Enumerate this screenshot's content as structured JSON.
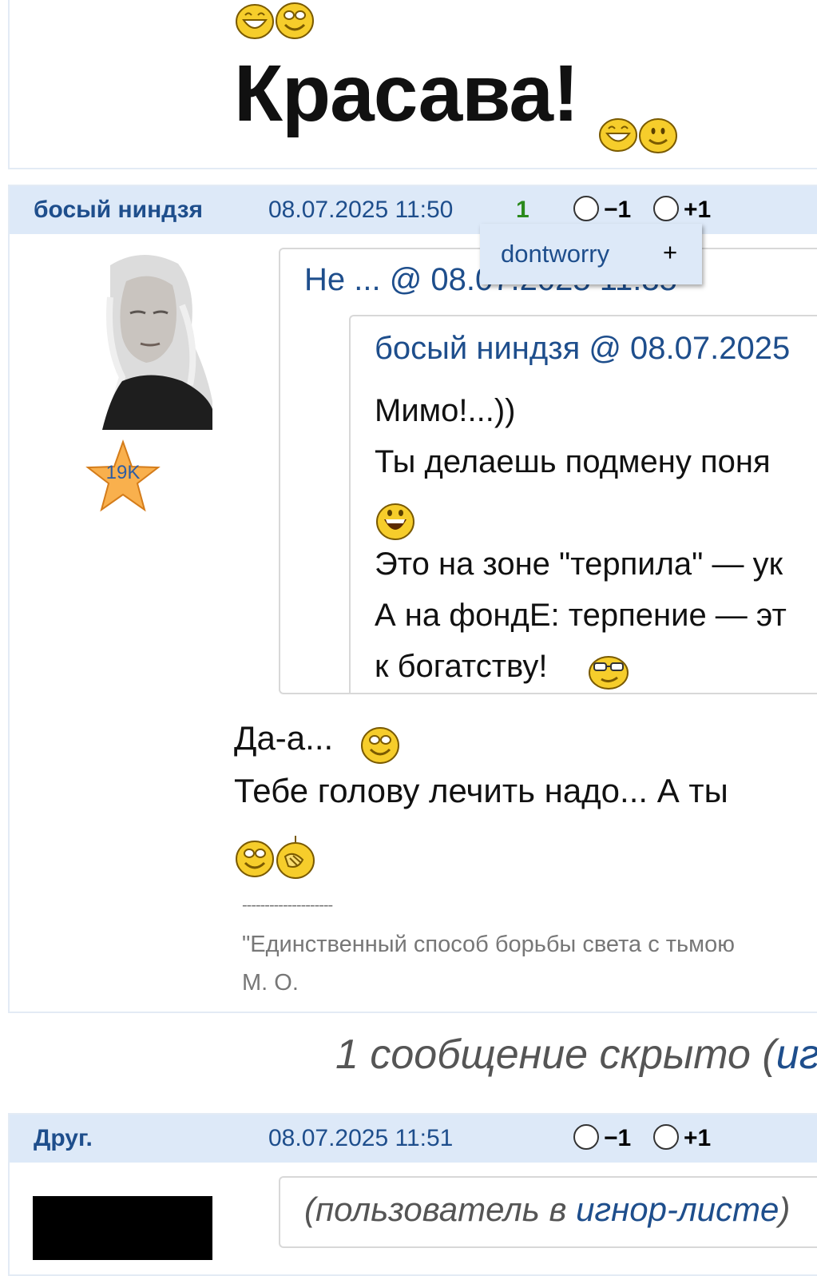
{
  "top_post": {
    "text": "Красава!"
  },
  "posts": [
    {
      "author": "босый ниндзя",
      "date": "08.07.2025 11:50",
      "score": "1",
      "vote_minus": "−1",
      "vote_plus": "+1",
      "rating_badge": "19K",
      "voters_popup": {
        "name": "dontworry",
        "sign": "+"
      },
      "quote": {
        "header": "Не ... @ 08.07.2025 11:35",
        "inner_quote": {
          "header": "босый ниндзя @ 08.07.2025",
          "lines": [
            "Мимо!...))",
            "Ты делаешь подмену поня",
            "Это на зоне \"терпила\" — ук",
            "А на фондЕ: терпение — эт",
            "к богатству!"
          ]
        }
      },
      "body_lines": [
        "Да-а...",
        "Тебе голову лечить надо... А ты"
      ],
      "signature": {
        "divider": "--------------------",
        "quote": "\"Единственный способ борьбы света с тьмою",
        "author": "М. О."
      }
    },
    {
      "author": "Друг.",
      "date": "08.07.2025 11:51",
      "vote_minus": "−1",
      "vote_plus": "+1",
      "ignored_text_prefix": "(пользователь в ",
      "ignored_link": "игнор-листе",
      "ignored_text_suffix": ")"
    }
  ],
  "hidden_notice": {
    "text": "1 сообщение скрыто (",
    "link": "иг"
  },
  "colors": {
    "header_bg": "#dde9f8",
    "link": "#1e4e8c",
    "score_green": "#2b8a1c",
    "smiley_yellow": "#f6cd2b"
  },
  "icons": [
    "smiley-icon",
    "star-rating-icon",
    "avatar-image",
    "radio-icon"
  ]
}
